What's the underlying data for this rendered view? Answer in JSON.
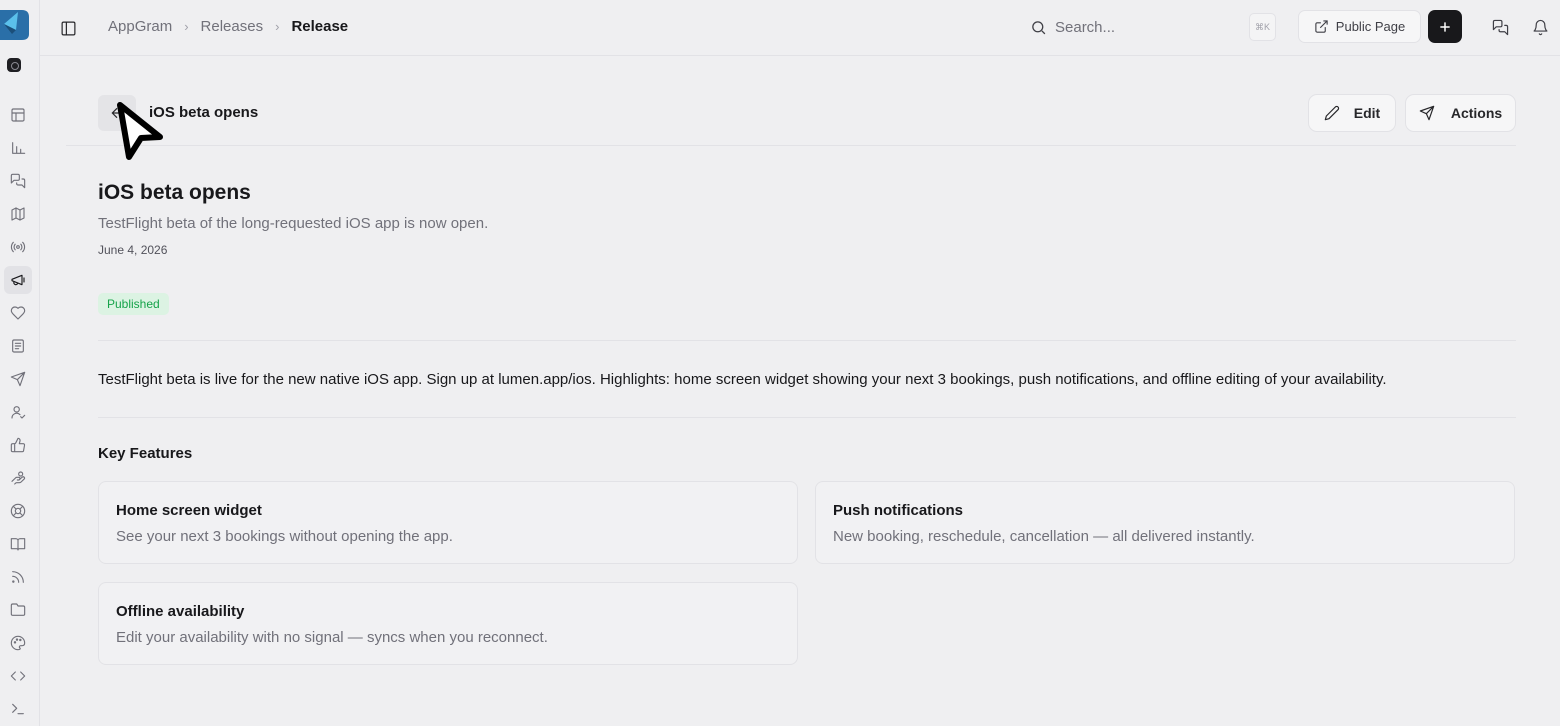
{
  "breadcrumb": [
    "AppGram",
    "Releases",
    "Release"
  ],
  "search": {
    "placeholder": "Search...",
    "shortcut": "⌘K"
  },
  "topbar": {
    "public_page_label": "Public Page"
  },
  "rail": {
    "items": [
      "layout-icon",
      "analytics-icon",
      "messages-icon",
      "roadmap-icon",
      "broadcast-icon",
      "megaphone-icon",
      "heart-icon",
      "forms-icon",
      "send-icon",
      "users-icon",
      "thumbs-up-icon",
      "hand-coins-icon",
      "help-icon",
      "book-icon",
      "rss-icon",
      "folder-icon",
      "palette-icon",
      "code-icon",
      "terminal-icon"
    ],
    "active": "megaphone-icon"
  },
  "header": {
    "title": "iOS beta opens",
    "edit_label": "Edit",
    "actions_label": "Actions"
  },
  "release": {
    "title": "iOS beta opens",
    "subtitle": "TestFlight beta of the long-requested iOS app is now open.",
    "date": "June 4, 2026",
    "status": "Published",
    "body": "TestFlight beta is live for the new native iOS app. Sign up at lumen.app/ios. Highlights: home screen widget showing your next 3 bookings, push notifications, and offline editing of your availability."
  },
  "key_features": {
    "heading": "Key Features",
    "items": [
      {
        "title": "Home screen widget",
        "description": "See your next 3 bookings without opening the app."
      },
      {
        "title": "Push notifications",
        "description": "New booking, reschedule, cancellation — all delivered instantly."
      },
      {
        "title": "Offline availability",
        "description": "Edit your availability with no signal — syncs when you reconnect."
      }
    ]
  },
  "colors": {
    "background": "#efeff1",
    "accent_dark": "#18181b",
    "published_bg": "#dcf3e3",
    "published_text": "#16a34a"
  }
}
